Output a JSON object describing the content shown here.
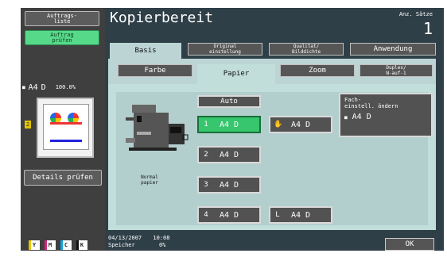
{
  "left": {
    "auftrags_liste": "Auftrags-\nliste",
    "auftrag_pruefen": "Auftrag\nprüfen",
    "thumb_size": "A4",
    "thumb_orient": "D",
    "thumb_zoom": "100.0%",
    "details_pruefen": "Details prüfen",
    "toners": [
      "Y",
      "M",
      "C",
      "K"
    ]
  },
  "header": {
    "title": "Kopierbereit",
    "anz_saetze_label": "Anz. Sätze",
    "anz_saetze_value": "1"
  },
  "tabs": {
    "basis": "Basis",
    "original_einstellung": "Original\neinstellung",
    "qualitat_bilddichte": "Qualitat/\nBilddichte",
    "anwendung": "Anwendung"
  },
  "subtabs": {
    "farbe": "Farbe",
    "papier": "Papier",
    "zoom": "Zoom",
    "duplex": "Duplex/\nN-auf-1"
  },
  "paper": {
    "auto": "Auto",
    "normal_papier": "Normal\npapier",
    "trays": [
      {
        "num": "1",
        "size": "A4 D"
      },
      {
        "num": "2",
        "size": "A4 D"
      },
      {
        "num": "3",
        "size": "A4 D"
      },
      {
        "num": "4",
        "size": "A4 D"
      }
    ],
    "bypass": {
      "icon": "hand-icon",
      "size": "A4 D"
    },
    "large": {
      "num": "L",
      "size": "A4 D"
    },
    "fach_label": "Fach-\neinstell. ändern",
    "fach_size": "A4 D"
  },
  "footer": {
    "date": "04/13/2007",
    "time": "10:08",
    "speicher": "Speicher",
    "speicher_value": "0%",
    "ok": "OK"
  },
  "colors": {
    "selected_green": "#37c56d",
    "panel_bg": "#c2dedb",
    "main_bg": "#2f3f48"
  }
}
